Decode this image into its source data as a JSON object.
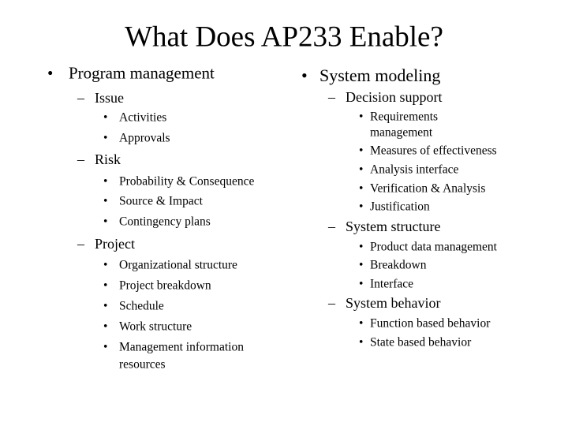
{
  "title": "What Does AP233 Enable?",
  "bullet_glyph": "•",
  "dash_glyph": "–",
  "left": {
    "heading": "Program management",
    "groups": [
      {
        "label": "Issue",
        "items": [
          "Activities",
          "Approvals"
        ]
      },
      {
        "label": "Risk",
        "items": [
          "Probability & Consequence",
          "Source & Impact",
          "Contingency plans"
        ]
      },
      {
        "label": "Project",
        "items": [
          "Organizational structure",
          "Project breakdown",
          "Schedule",
          "Work structure",
          "Management information",
          "resources"
        ]
      }
    ]
  },
  "right": {
    "heading": "System modeling",
    "groups": [
      {
        "label": "Decision support",
        "items": [
          "Requirements",
          "management",
          "Measures of effectiveness",
          "Analysis interface",
          "Verification & Analysis",
          "Justification"
        ]
      },
      {
        "label": "System structure",
        "items": [
          "Product data management",
          "Breakdown",
          "Interface"
        ]
      },
      {
        "label": "System behavior",
        "items": [
          "Function based behavior",
          "State based behavior"
        ]
      }
    ]
  }
}
